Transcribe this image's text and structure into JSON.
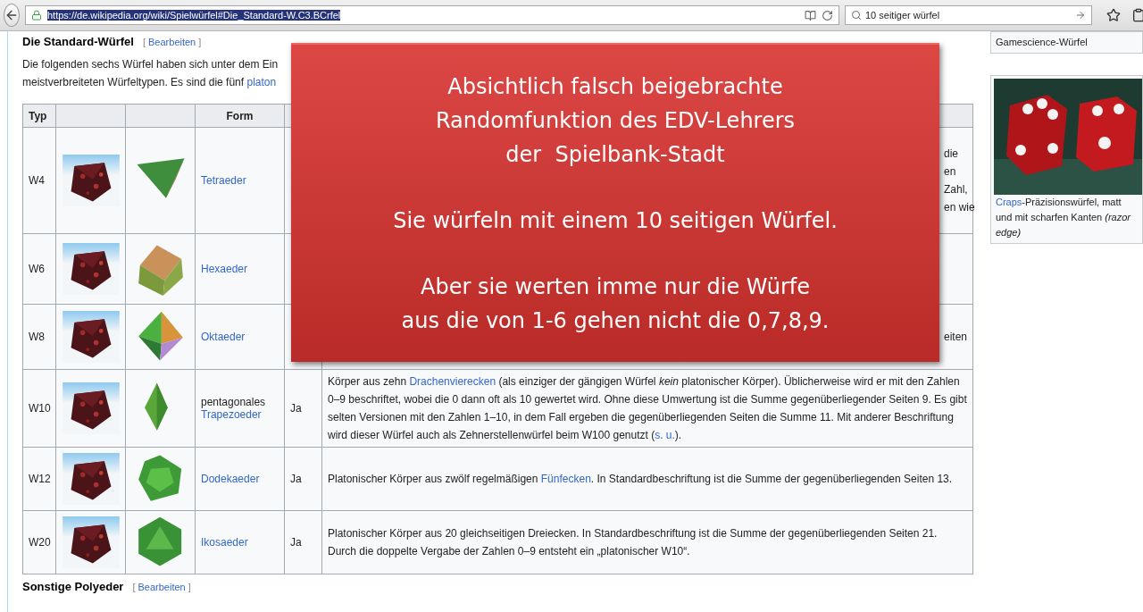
{
  "browser": {
    "url": "https://de.wikipedia.org/wiki/Spielwürfel#Die_Standard-W.C3.BCrfel",
    "url_selected": true,
    "search": "10 seitiger würfel"
  },
  "heading": {
    "title": "Die Standard-Würfel",
    "edit_open": "[",
    "edit_link": "Bearbeiten",
    "edit_close": "]"
  },
  "intro": [
    [
      {
        "text": "Die folgenden sechs Würfel haben sich unter dem Ein"
      }
    ],
    [
      {
        "text": "meistverbreiteten Würfeltypen. Es sind die fünf "
      },
      {
        "text": "platon",
        "link": true
      }
    ]
  ],
  "table": {
    "header": {
      "column_1": "Typ",
      "column_4": "Form"
    },
    "rows": [
      {
        "typ": "W4",
        "form_link": "Tetraeder",
        "kind": "covered",
        "fragments": [
          "die",
          "en",
          "Zahl,",
          "en wie"
        ]
      },
      {
        "typ": "W6",
        "form_link": "Hexaeder",
        "kind": "covered",
        "fragments": []
      },
      {
        "typ": "W8",
        "form_link": "Oktaeder",
        "kind": "covered",
        "fragments": [
          "eiten"
        ]
      },
      {
        "typ": "W10",
        "form_prefix": "pentagonales",
        "form_link": "Trapezoeder",
        "platonic": "Ja",
        "kind": "text",
        "segments": [
          {
            "text": "Körper aus zehn "
          },
          {
            "text": "Drachenvierecken",
            "link": true
          },
          {
            "text": " (als einziger der gängigen Würfel *kein* platonischer Körper). Üblicherweise wird er mit den Zahlen 0–9 beschriftet, wobei die 0 dann oft als 10 gewertet wird. Ohne diese Umwertung ist die Summe gegenüberliegender Seiten 9. Es gibt selten Versionen mit den Zahlen 1–10, in dem Fall ergeben die gegenüberliegenden Seiten die Summe 11. Mit anderer Beschriftung wird dieser Würfel auch als Zehnerstellenwürfel beim W100 genutzt ("
          },
          {
            "text": "s. u.",
            "link": true
          },
          {
            "text": ")."
          }
        ]
      },
      {
        "typ": "W12",
        "form_link": "Dodekaeder",
        "platonic": "Ja",
        "kind": "text",
        "segments": [
          {
            "text": "Platonischer Körper aus zwölf regelmäßigen "
          },
          {
            "text": "Fünfecken",
            "link": true
          },
          {
            "text": ". In Standardbeschriftung ist die Summe der gegenüberliegenden Seiten 13."
          }
        ]
      },
      {
        "typ": "W20",
        "form_link": "Ikosaeder",
        "platonic": "Ja",
        "kind": "text",
        "segments": [
          {
            "text": "Platonischer Körper aus 20 gleichseitigen Dreiecken. In Standardbeschriftung ist die Summe der gegenüberliegenden Seiten 21. Durch die doppelte Vergabe der Zahlen 0–9 entsteht ein „platonischer W10“."
          }
        ]
      }
    ]
  },
  "next_heading": {
    "title": "Sonstige Polyeder",
    "edit_open": "[",
    "edit_link": "Bearbeiten",
    "edit_close": "]"
  },
  "sidebar": [
    {
      "caption": [
        {
          "text": "Gamescience-Würfel"
        }
      ]
    },
    {
      "kind": "picture",
      "caption": [
        {
          "text": "Craps",
          "link": true
        },
        {
          "text": "-Präzisionswürfel, matt und mit scharfen Kanten *(razor edge)*"
        }
      ]
    }
  ],
  "overlay": {
    "paragraphs": [
      "Absichtlich falsch beigebrachte\nRandomfunktion des EDV-Lehrers\nder  Spielbank-Stadt",
      "Sie würfeln mit einem 10 seitigen Würfel.",
      "Aber sie werten imme nur die Würfe\naus die von 1-6 gehen nicht die 0,7,8,9."
    ]
  }
}
